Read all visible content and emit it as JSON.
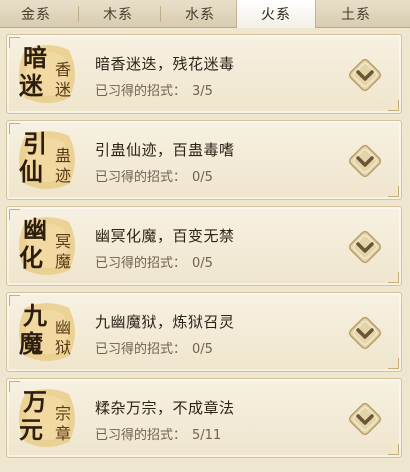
{
  "tabs": [
    {
      "label": "金系"
    },
    {
      "label": "木系"
    },
    {
      "label": "水系"
    },
    {
      "label": "火系"
    },
    {
      "label": "土系"
    }
  ],
  "active_tab": "火系",
  "colors": {
    "card_bg": "#f4ecd8",
    "emblem_gold": "#e7c77c",
    "diamond_fill": "#e2d2a6",
    "chevron": "#6a5534"
  },
  "icons": {
    "expand": "chevron-down-diamond-icon"
  },
  "progress_label": "已习得的招式：",
  "skills": [
    {
      "emblem": [
        "暗",
        "迷",
        "香",
        "迷"
      ],
      "description": "暗香迷迭，残花迷毒",
      "learned": "3/5"
    },
    {
      "emblem": [
        "引",
        "仙",
        "蛊",
        "迹"
      ],
      "description": "引蛊仙迹，百蛊毒嗜",
      "learned": "0/5"
    },
    {
      "emblem": [
        "幽",
        "化",
        "冥",
        "魔"
      ],
      "description": "幽冥化魔，百变无禁",
      "learned": "0/5"
    },
    {
      "emblem": [
        "九",
        "魔",
        "幽",
        "狱"
      ],
      "description": "九幽魔狱，炼狱召灵",
      "learned": "0/5"
    },
    {
      "emblem": [
        "万",
        "元",
        "宗",
        "章"
      ],
      "description": "糅杂万宗，不成章法",
      "learned": "5/11"
    }
  ]
}
